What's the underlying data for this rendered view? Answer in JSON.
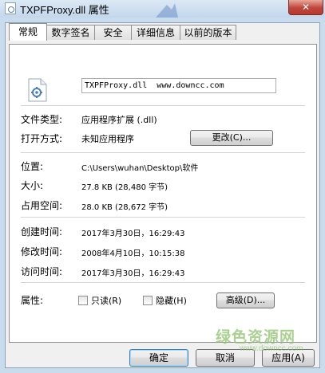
{
  "window": {
    "title": "TXPFProxy.dll 属性",
    "close_label": "✕"
  },
  "tabs": [
    {
      "label": "常规",
      "active": true
    },
    {
      "label": "数字签名"
    },
    {
      "label": "安全"
    },
    {
      "label": "详细信息"
    },
    {
      "label": "以前的版本"
    }
  ],
  "general": {
    "file_name": "TXPFProxy.dll  www.downcc.com",
    "file_type_label": "文件类型:",
    "file_type_value": "应用程序扩展 (.dll)",
    "opens_with_label": "打开方式:",
    "opens_with_value": "未知应用程序",
    "change_button": "更改(C)...",
    "location_label": "位置:",
    "location_value": "C:\\Users\\wuhan\\Desktop\\软件",
    "size_label": "大小:",
    "size_value": "27.8 KB (28,480 字节)",
    "size_on_disk_label": "占用空间:",
    "size_on_disk_value": "28.0 KB (28,672 字节)",
    "created_label": "创建时间:",
    "created_value": "2017年3月30日，16:29:43",
    "modified_label": "修改时间:",
    "modified_value": "2008年4月10日，10:15:38",
    "accessed_label": "访问时间:",
    "accessed_value": "2017年3月30日，16:29:43",
    "attributes_label": "属性:",
    "readonly_label": "只读(R)",
    "hidden_label": "隐藏(H)",
    "advanced_button": "高级(D)..."
  },
  "footer": {
    "ok_button": "确定",
    "cancel_button": "取消",
    "apply_button": "应用(A)"
  },
  "watermark": {
    "text": "绿色资源网",
    "sub": "www.downcc.com"
  },
  "icons": {
    "file": "dll-file-icon",
    "close": "close-icon"
  }
}
